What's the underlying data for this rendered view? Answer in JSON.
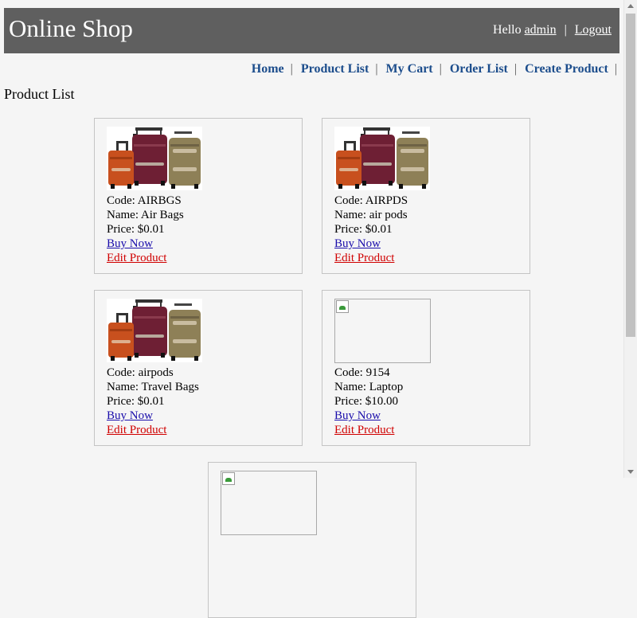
{
  "header": {
    "title": "Online Shop",
    "greeting": "Hello",
    "username": "admin",
    "separator": "|",
    "logout": "Logout"
  },
  "menu": {
    "items": [
      {
        "label": "Home"
      },
      {
        "label": "Product List"
      },
      {
        "label": "My Cart"
      },
      {
        "label": "Order List"
      },
      {
        "label": "Create Product"
      }
    ],
    "separator": "|"
  },
  "page_heading": "Product List",
  "products": [
    {
      "code_text": "Code: AIRBGS",
      "name_text": "Name: Air Bags",
      "price_text": "Price: $0.01",
      "buy": "Buy Now",
      "edit": "Edit Product",
      "image": "luggage-set"
    },
    {
      "code_text": "Code: AIRPDS",
      "name_text": "Name: air pods",
      "price_text": "Price: $0.01",
      "buy": "Buy Now",
      "edit": "Edit Product",
      "image": "luggage-set"
    },
    {
      "code_text": "Code: airpods",
      "name_text": "Name: Travel Bags",
      "price_text": "Price: $0.01",
      "buy": "Buy Now",
      "edit": "Edit Product",
      "image": "luggage-set"
    },
    {
      "code_text": "Code: 9154",
      "name_text": "Name: Laptop",
      "price_text": "Price: $10.00",
      "buy": "Buy Now",
      "edit": "Edit Product",
      "image": "broken-image"
    },
    {
      "image": "broken-image"
    }
  ],
  "colors": {
    "header_bg": "#5f5f5f",
    "menu_link": "#1c4d8c",
    "buy_link": "#1a0dab",
    "edit_link": "#d00000",
    "page_bg": "#f5f5f5"
  }
}
